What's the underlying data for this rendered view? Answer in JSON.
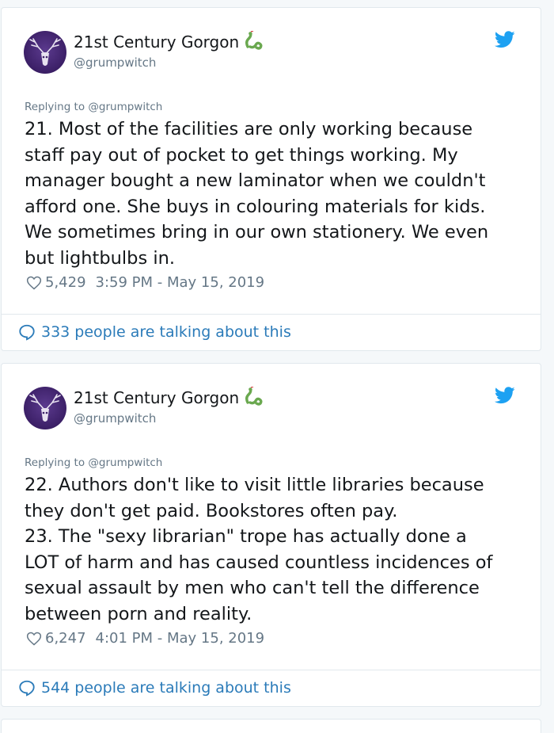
{
  "tweets": [
    {
      "display_name": "21st Century Gorgon",
      "handle": "@grumpwitch",
      "reply_to": "Replying to @grumpwitch",
      "text": "21. Most of the facilities are only working because\nstaff pay out of pocket to get things working. My\nmanager bought a new laminator when we couldn't\nafford one. She buys in colouring materials for kids.\nWe sometimes bring in our own stationery. We even\nbut lightbulbs in.",
      "likes": "5,429",
      "timestamp": "3:59 PM - May 15, 2019",
      "talking": "333 people are talking about this"
    },
    {
      "display_name": "21st Century Gorgon",
      "handle": "@grumpwitch",
      "reply_to": "Replying to @grumpwitch",
      "text": "22. Authors don't like to visit little libraries because\nthey don't get paid. Bookstores often pay.\n23. The \"sexy librarian\" trope has actually done a\nLOT of harm and has caused countless incidences of\nsexual assault by men who can't tell the difference\nbetween porn and reality.",
      "likes": "6,247",
      "timestamp": "4:01 PM - May 15, 2019",
      "talking": "544 people are talking about this"
    }
  ],
  "colors": {
    "twitter_blue": "#1da1f2",
    "link_blue": "#2b7bb9",
    "muted": "#657786",
    "avatar_purple": "#3b1f66",
    "snake_green": "#6aa84f"
  },
  "icons": {
    "bird": "twitter-bird-icon",
    "heart": "heart-outline-icon",
    "bubble": "speech-bubble-icon",
    "emoji": "snake-emoji-icon"
  }
}
